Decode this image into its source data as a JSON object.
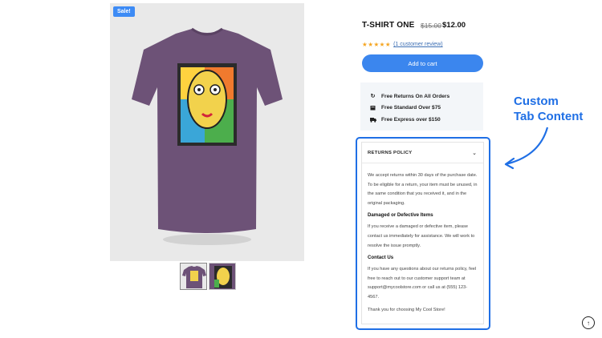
{
  "product": {
    "sale_badge": "Sale!",
    "title": "T-SHIRT ONE",
    "price_old": "$15.00",
    "price_new": "$12.00",
    "stars": "★★★★★",
    "review_link": "(1 customer review)",
    "rating_value": 5,
    "add_to_cart": "Add to cart"
  },
  "perks": [
    {
      "icon": "refresh-icon",
      "label": "Free Returns On All Orders"
    },
    {
      "icon": "box-icon",
      "label": "Free Standard Over $75"
    },
    {
      "icon": "truck-icon",
      "label": "Free Express over $150"
    }
  ],
  "tab": {
    "title": "RETURNS POLICY",
    "para1": "We accept returns within 30 days of the purchase date. To be eligible for a return, your item must be unused, in the same condition that you received it, and in the original packaging.",
    "heading2": "Damaged or Defective Items",
    "para2": "If you receive a damaged or defective item, please contact us immediately for assistance. We will work to resolve the issue promptly.",
    "heading3": "Contact Us",
    "para3": "If you have any questions about our returns policy, feel free to reach out to our customer support team at support@mycoolstore.com or call us at (555) 123-4567.",
    "para4": "Thank you for choosing My Cool Store!"
  },
  "callout": {
    "line1": "Custom",
    "line2": "Tab Content"
  },
  "colors": {
    "accent": "#3b86ee",
    "highlight": "#1f6fe5",
    "shirt": "#6d5277",
    "star": "#f5a623"
  }
}
